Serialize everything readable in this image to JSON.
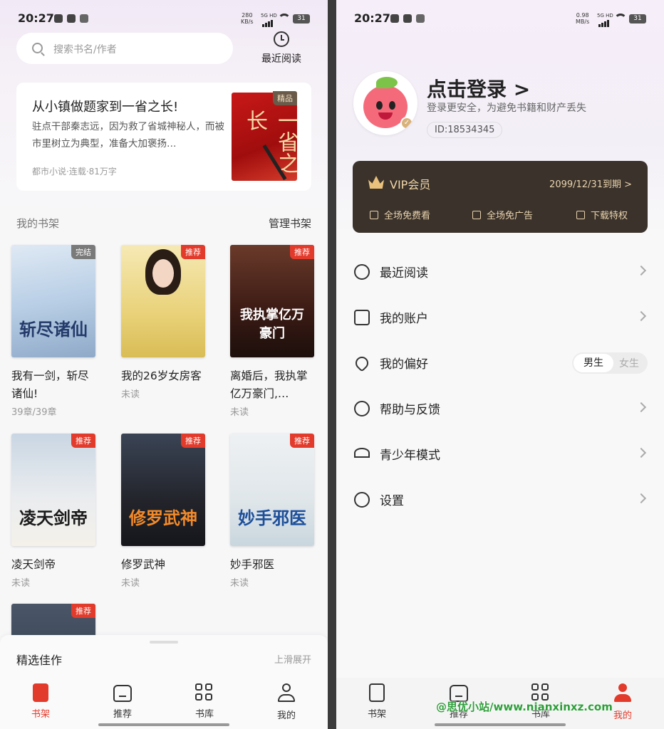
{
  "left": {
    "status": {
      "time": "20:27",
      "speed_top": "280",
      "speed_unit": "KB/s",
      "signal": "5G HD",
      "battery": "31"
    },
    "search": {
      "placeholder": "搜索书名/作者"
    },
    "recent_label": "最近阅读",
    "featured": {
      "title": "从小镇做题家到一省之长!",
      "description": "驻点干部秦志远，因为救了省城神秘人，而被市里树立为典型，准备大加褒扬…",
      "meta": "都市小说·连载·81万字",
      "badge": "精品",
      "cover_text": "一省之长"
    },
    "shelf": {
      "title": "我的书架",
      "manage": "管理书架",
      "books": [
        {
          "name": "我有一剑，斩尽诸仙!",
          "progress": "39章/39章",
          "tag": "完结",
          "cover_text": "斩尽诸仙"
        },
        {
          "name": "我的26岁女房客",
          "progress": "未读",
          "tag": "推荐",
          "cover_text": ""
        },
        {
          "name": "离婚后，我执掌亿万豪门,…",
          "progress": "未读",
          "tag": "推荐",
          "cover_text": "我执掌亿万豪门"
        },
        {
          "name": "凌天剑帝",
          "progress": "未读",
          "tag": "推荐",
          "cover_text": "凌天剑帝"
        },
        {
          "name": "修罗武神",
          "progress": "未读",
          "tag": "推荐",
          "cover_text": "修罗武神"
        },
        {
          "name": "妙手邪医",
          "progress": "未读",
          "tag": "推荐",
          "cover_text": "妙手邪医"
        },
        {
          "name": "",
          "progress": "",
          "tag": "推荐",
          "cover_text": ""
        }
      ]
    },
    "drawer": {
      "title": "精选佳作",
      "hint": "上滑展开"
    },
    "tabs": [
      "书架",
      "推荐",
      "书库",
      "我的"
    ]
  },
  "right": {
    "status": {
      "time": "20:27",
      "speed_top": "0.98",
      "speed_unit": "MB/s",
      "signal": "5G HD",
      "battery": "31"
    },
    "login": "点击登录 >",
    "login_sub": "登录更安全，为避免书籍和财产丢失",
    "uid": "ID:18534345",
    "vip": {
      "title": "VIP会员",
      "expiry": "2099/12/31到期 >",
      "perks": [
        "全场免费看",
        "全场免广告",
        "下载特权"
      ]
    },
    "menu": [
      {
        "label": "最近阅读",
        "icon": "clock-icon"
      },
      {
        "label": "我的账户",
        "icon": "account-icon"
      },
      {
        "label": "我的偏好",
        "icon": "heart-icon"
      },
      {
        "label": "帮助与反馈",
        "icon": "help-icon"
      },
      {
        "label": "青少年模式",
        "icon": "umbrella-icon"
      },
      {
        "label": "设置",
        "icon": "settings-icon"
      }
    ],
    "preference": {
      "male": "男生",
      "female": "女生"
    },
    "tabs": [
      "书架",
      "推荐",
      "书库",
      "我的"
    ]
  },
  "watermark": "@思优小站/www.nianxinxz.com",
  "colors": {
    "accent": "#e23a2b",
    "vip_bg": "#3a322b",
    "vip_gold": "#e9c17d"
  }
}
